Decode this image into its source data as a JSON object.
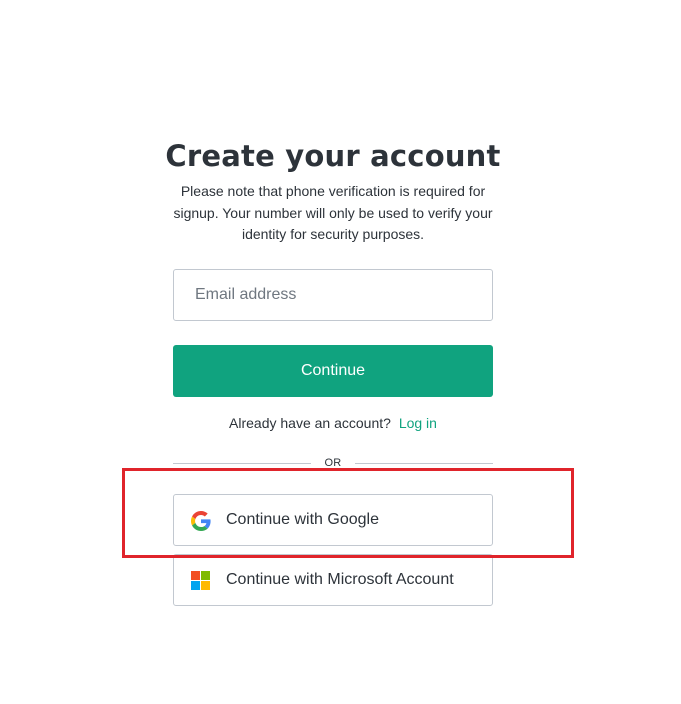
{
  "page": {
    "title": "Create your account",
    "subtitle": "Please note that phone verification is required for signup. Your number will only be used to verify your identity for security purposes."
  },
  "form": {
    "email_placeholder": "Email address",
    "email_value": "",
    "continue_label": "Continue"
  },
  "login": {
    "prompt": "Already have an account?",
    "link_label": "Log in"
  },
  "divider": {
    "label": "OR"
  },
  "social": {
    "google_label": "Continue with Google",
    "google_icon": "google-icon",
    "microsoft_label": "Continue with Microsoft Account",
    "microsoft_icon": "microsoft-icon"
  },
  "colors": {
    "accent": "#10a37f",
    "text": "#2d333a",
    "border": "#c2c8d0",
    "highlight": "#e0242b",
    "microsoft_red": "#f25022",
    "microsoft_green": "#7fba00",
    "microsoft_blue": "#00a4ef",
    "microsoft_yellow": "#ffb900"
  }
}
